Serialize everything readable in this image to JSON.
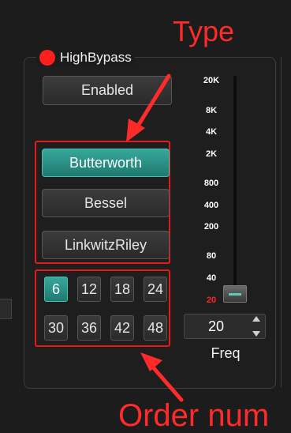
{
  "group": {
    "title": "HighBypass",
    "led_color": "#ff1d1d"
  },
  "enabled_button": {
    "label": "Enabled"
  },
  "filter_types": [
    {
      "label": "Butterworth",
      "selected": true
    },
    {
      "label": "Bessel",
      "selected": false
    },
    {
      "label": "LinkwitzRiley",
      "selected": false
    }
  ],
  "orders": [
    {
      "label": "6",
      "selected": true
    },
    {
      "label": "12",
      "selected": false
    },
    {
      "label": "18",
      "selected": false
    },
    {
      "label": "24",
      "selected": false
    },
    {
      "label": "30",
      "selected": false
    },
    {
      "label": "36",
      "selected": false
    },
    {
      "label": "42",
      "selected": false
    },
    {
      "label": "48",
      "selected": false
    }
  ],
  "freq_slider": {
    "ticks": [
      "20K",
      "8K",
      "4K",
      "2K",
      "800",
      "400",
      "200",
      "80",
      "40",
      "20"
    ],
    "current_tick": "20"
  },
  "freq_spinbox": {
    "value": "20",
    "label": "Freq"
  },
  "annotations": {
    "type_label": "Type",
    "order_label": "Order num",
    "color": "#ff2a2a"
  },
  "colors": {
    "accent": "#2a9488",
    "highlight_red": "#e11c1c",
    "background": "#1c1c1c"
  }
}
